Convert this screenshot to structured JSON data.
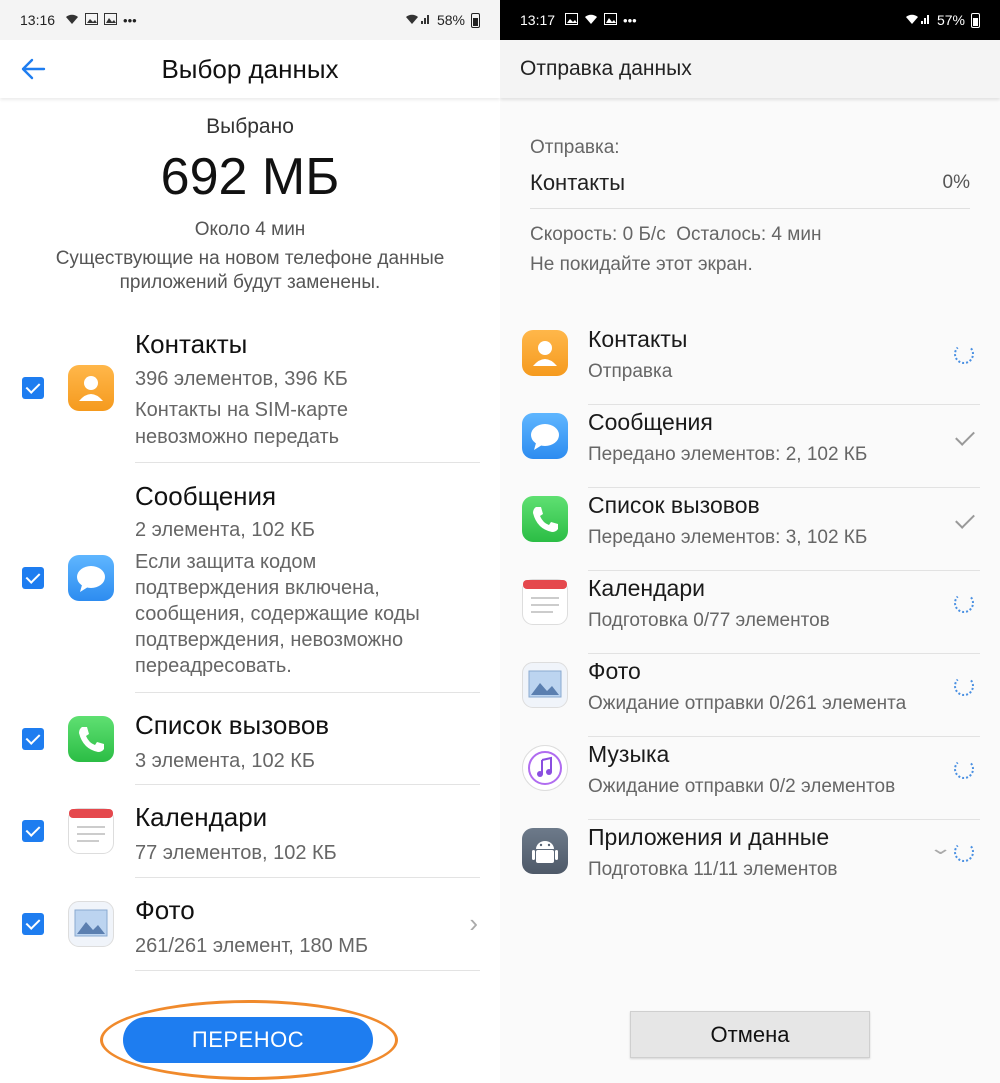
{
  "left": {
    "status": {
      "time": "13:16",
      "battery": "58%"
    },
    "title": "Выбор данных",
    "summary": {
      "label": "Выбрано",
      "size": "692 МБ",
      "time": "Около 4 мин",
      "note": "Существующие на новом телефоне данные приложений будут заменены."
    },
    "items": [
      {
        "name": "Контакты",
        "lines": [
          "396 элементов, 396 КБ",
          "Контакты на SIM-карте",
          "невозможно передать"
        ],
        "checked": true,
        "icon": "contacts-icon"
      },
      {
        "name": "Сообщения",
        "lines": [
          "2 элемента, 102 КБ",
          "Если защита кодом",
          "подтверждения включена,",
          "сообщения, содержащие коды",
          "подтверждения, невозможно",
          "переадресовать."
        ],
        "checked": true,
        "icon": "messages-icon"
      },
      {
        "name": "Список вызовов",
        "lines": [
          "3 элемента, 102 КБ"
        ],
        "checked": true,
        "icon": "phone-icon"
      },
      {
        "name": "Календари",
        "lines": [
          "77 элементов, 102 КБ"
        ],
        "checked": true,
        "icon": "calendar-icon"
      },
      {
        "name": "Фото",
        "lines": [
          "261/261 элемент, 180 МБ"
        ],
        "checked": true,
        "icon": "photo-icon"
      }
    ],
    "transfer_button": "ПЕРЕНОС"
  },
  "right": {
    "status": {
      "time": "13:17",
      "battery": "57%"
    },
    "title": "Отправка данных",
    "sending_label": "Отправка:",
    "sending_item": "Контакты",
    "sending_percent": "0%",
    "speed": "Скорость: 0 Б/с",
    "remaining": "Осталось: 4 мин",
    "stay_note": "Не покидайте этот экран.",
    "items": [
      {
        "name": "Контакты",
        "sub": "Отправка",
        "state": "spinner",
        "icon": "contacts-icon"
      },
      {
        "name": "Сообщения",
        "sub": "Передано элементов: 2, 102 КБ",
        "state": "done",
        "icon": "messages-icon"
      },
      {
        "name": "Список вызовов",
        "sub": "Передано элементов: 3, 102 КБ",
        "state": "done",
        "icon": "phone-icon"
      },
      {
        "name": "Календари",
        "sub": "Подготовка 0/77 элементов",
        "state": "spinner",
        "icon": "calendar-icon"
      },
      {
        "name": "Фото",
        "sub": "Ожидание отправки 0/261 элемента",
        "state": "spinner",
        "icon": "photo-icon"
      },
      {
        "name": "Музыка",
        "sub": "Ожидание отправки 0/2 элементов",
        "state": "spinner",
        "icon": "music-icon"
      },
      {
        "name": "Приложения и данные",
        "sub": "Подготовка 11/11 элементов",
        "state": "spinner",
        "icon": "android-icon"
      }
    ],
    "cancel_button": "Отмена"
  },
  "colors": {
    "accent": "#1e7df0",
    "highlight_ring": "#f08a2c"
  }
}
